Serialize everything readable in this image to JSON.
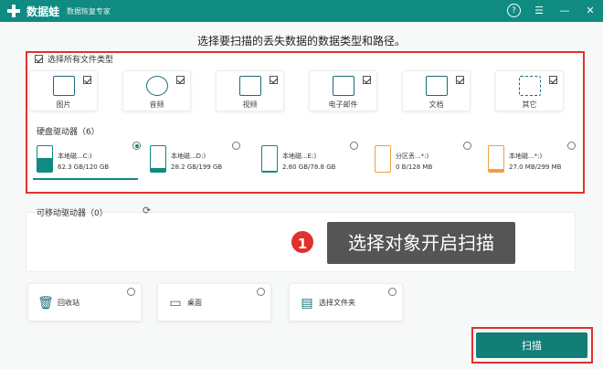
{
  "titlebar": {
    "app_name": "数据蛙",
    "subtitle": "数据恢复专家",
    "help_label": "?",
    "menu_label": "☰",
    "minimize_label": "—",
    "close_label": "✕"
  },
  "heading": "选择要扫描的丢失数据的数据类型和路径。",
  "file_types": {
    "select_all_label": "选择所有文件类型",
    "items": [
      {
        "label": "图片",
        "icon": "image-icon"
      },
      {
        "label": "音频",
        "icon": "music-icon"
      },
      {
        "label": "视频",
        "icon": "video-icon"
      },
      {
        "label": "电子邮件",
        "icon": "mail-icon"
      },
      {
        "label": "文档",
        "icon": "document-icon"
      },
      {
        "label": "其它",
        "icon": "grid-icon"
      }
    ]
  },
  "drives": {
    "header": "硬盘驱动器（6）",
    "items": [
      {
        "name": "本地磁...C:)",
        "size": "62.3 GB/120 GB",
        "fill_fraction": 0.52,
        "selected": true
      },
      {
        "name": "本地磁...D:)",
        "size": "28.2 GB/199 GB",
        "fill_fraction": 0.14,
        "selected": false
      },
      {
        "name": "本地磁...E:)",
        "size": "2.80 GB/78.8 GB",
        "fill_fraction": 0.04,
        "selected": false
      },
      {
        "name": "分区丢...*:)",
        "size": "0 B/128 MB",
        "fill_fraction": 0.0,
        "selected": false
      },
      {
        "name": "本地磁...*:)",
        "size": "27.0 MB/299 MB",
        "fill_fraction": 0.09,
        "selected": false
      }
    ]
  },
  "removable": {
    "label": "可移动驱动器（0）"
  },
  "callout": {
    "step": "1",
    "text": "选择对象开启扫描"
  },
  "locations": [
    {
      "label": "回收站",
      "icon": "trash-icon"
    },
    {
      "label": "桌面",
      "icon": "desktop-icon"
    },
    {
      "label": "选择文件夹",
      "icon": "folder-icon"
    }
  ],
  "scan_label": "扫描",
  "colors": {
    "accent": "#0f8b82",
    "highlight": "#e0312d",
    "orange": "#f0a040"
  }
}
